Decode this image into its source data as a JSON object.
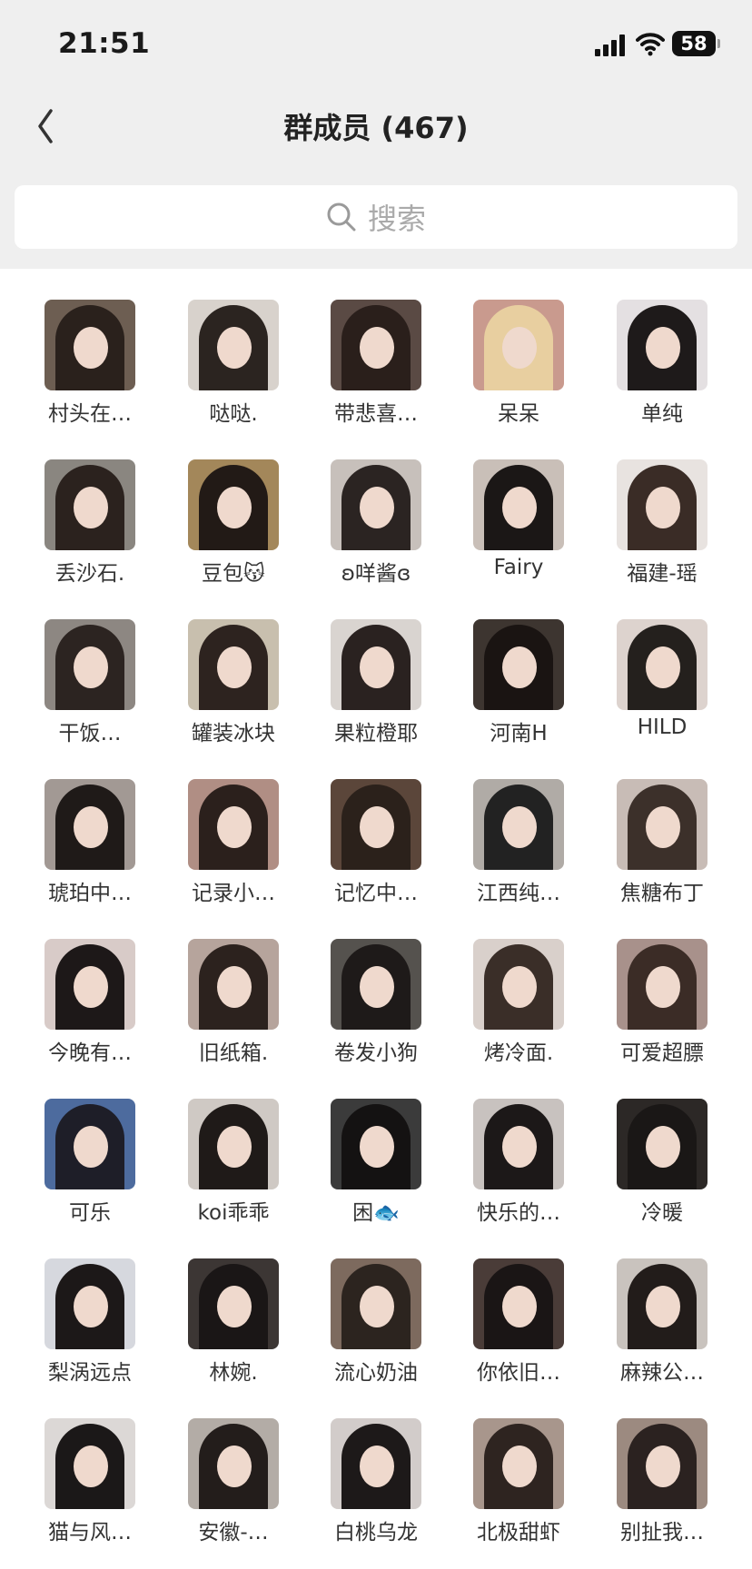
{
  "status_bar": {
    "time": "21:51",
    "battery": "58"
  },
  "header": {
    "title": "群成员 (467)"
  },
  "search": {
    "placeholder": "搜索"
  },
  "members": [
    {
      "name": "村头在…",
      "bg": "#6d5e52",
      "hair": "#2a211c"
    },
    {
      "name": "哒哒.",
      "bg": "#d8d2cc",
      "hair": "#2b2420"
    },
    {
      "name": "带悲喜…",
      "bg": "#5a4a44",
      "hair": "#2a1f1b"
    },
    {
      "name": "呆呆",
      "bg": "#c99a8e",
      "hair": "#e8cfa0"
    },
    {
      "name": "单纯",
      "bg": "#e4e0e2",
      "hair": "#1e1a1a"
    },
    {
      "name": "丢沙石.",
      "bg": "#8a8680",
      "hair": "#2b221e"
    },
    {
      "name": "豆包😽",
      "bg": "#a3875a",
      "hair": "#221a16"
    },
    {
      "name": "ʚ咩酱ɞ",
      "bg": "#c7c0bb",
      "hair": "#2b2422"
    },
    {
      "name": "Fairy",
      "bg": "#c9bfb8",
      "hair": "#1b1716"
    },
    {
      "name": "福建-瑶",
      "bg": "#e8e3e0",
      "hair": "#3a2c26"
    },
    {
      "name": "干饭…",
      "bg": "#8d8782",
      "hair": "#2c2421"
    },
    {
      "name": "罐装冰块",
      "bg": "#c8bfae",
      "hair": "#2d231f"
    },
    {
      "name": "果粒橙耶",
      "bg": "#d9d4d0",
      "hair": "#2a2220"
    },
    {
      "name": "河南H",
      "bg": "#3d3530",
      "hair": "#1a1412"
    },
    {
      "name": "HILD",
      "bg": "#ddd3ce",
      "hair": "#24201d"
    },
    {
      "name": "琥珀中…",
      "bg": "#a29994",
      "hair": "#1f1a18"
    },
    {
      "name": "记录小…",
      "bg": "#b08e84",
      "hair": "#2b201c"
    },
    {
      "name": "记忆中…",
      "bg": "#5b463a",
      "hair": "#2b211b"
    },
    {
      "name": "江西纯…",
      "bg": "#b0aba6",
      "hair": "#222"
    },
    {
      "name": "焦糖布丁",
      "bg": "#c8bcb6",
      "hair": "#3c302a"
    },
    {
      "name": "今晚有…",
      "bg": "#d8cbc8",
      "hair": "#1d1818"
    },
    {
      "name": "旧纸箱.",
      "bg": "#b6a49c",
      "hair": "#2c221e"
    },
    {
      "name": "卷发小狗",
      "bg": "#55524e",
      "hair": "#1e1a19"
    },
    {
      "name": "烤冷面.",
      "bg": "#d9d0cb",
      "hair": "#3a2e28"
    },
    {
      "name": "可爱超膘",
      "bg": "#a8918b",
      "hair": "#3b2c26"
    },
    {
      "name": "可乐",
      "bg": "#4d6b9e",
      "hair": "#1e1e28"
    },
    {
      "name": "koi乖乖",
      "bg": "#cfc9c4",
      "hair": "#1f1a18"
    },
    {
      "name": "困🐟",
      "bg": "#3b3b3b",
      "hair": "#141212"
    },
    {
      "name": "快乐的…",
      "bg": "#c8c2bf",
      "hair": "#1c1818"
    },
    {
      "name": "冷暖",
      "bg": "#2c2826",
      "hair": "#1a1716"
    },
    {
      "name": "梨涡远点",
      "bg": "#d6d8de",
      "hair": "#1c1818"
    },
    {
      "name": "林婉.",
      "bg": "#3c3634",
      "hair": "#1a1616"
    },
    {
      "name": "流心奶油",
      "bg": "#7d6a5e",
      "hair": "#2c241f"
    },
    {
      "name": "你依旧…",
      "bg": "#4a3c38",
      "hair": "#1a1515"
    },
    {
      "name": "麻辣公…",
      "bg": "#c9c3be",
      "hair": "#221c1a"
    },
    {
      "name": "猫与风…",
      "bg": "#dcd8d6",
      "hair": "#1b1818"
    },
    {
      "name": "安徽-…",
      "bg": "#b3aca6",
      "hair": "#231d1b"
    },
    {
      "name": "白桃乌龙",
      "bg": "#d2ccca",
      "hair": "#1d1919"
    },
    {
      "name": "北极甜虾",
      "bg": "#a8968c",
      "hair": "#2e2420"
    },
    {
      "name": "别扯我…",
      "bg": "#9c8a80",
      "hair": "#2b2220"
    }
  ]
}
